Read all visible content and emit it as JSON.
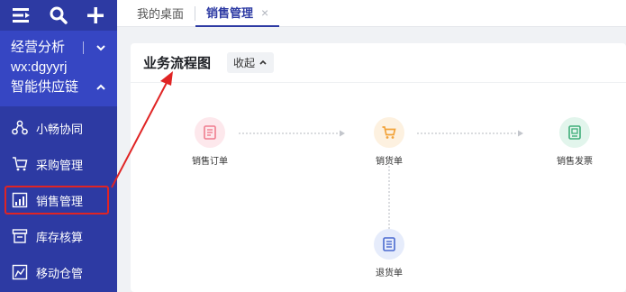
{
  "sidebar": {
    "brand_line1": "经营分析",
    "brand_line2": "wx:dgyyrj",
    "brand_line3": "智能供应链",
    "items": [
      {
        "label": "小畅协同"
      },
      {
        "label": "采购管理"
      },
      {
        "label": "销售管理"
      },
      {
        "label": "库存核算"
      },
      {
        "label": "移动仓管"
      }
    ]
  },
  "tabs": [
    {
      "label": "我的桌面"
    },
    {
      "label": "销售管理",
      "close": "×"
    }
  ],
  "card": {
    "title": "业务流程图",
    "collapse_label": "收起"
  },
  "flow": {
    "nodes": [
      {
        "label": "销售订单"
      },
      {
        "label": "销货单"
      },
      {
        "label": "销售发票"
      },
      {
        "label": "退货单"
      }
    ]
  },
  "colors": {
    "sidebar_bg": "#2d3aa3",
    "brand_bg": "#3646c3",
    "highlight": "#e02424",
    "order_icon": "#f07c8e",
    "delivery_icon": "#f2a33a",
    "invoice_icon": "#3fae7a",
    "return_icon": "#4a6ad0"
  }
}
